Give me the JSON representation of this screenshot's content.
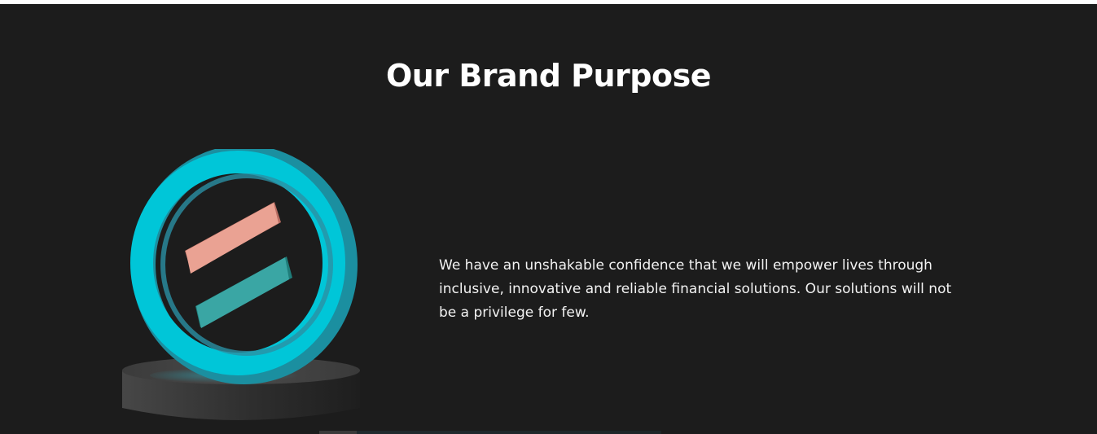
{
  "section": {
    "title": "Our Brand Purpose",
    "description": "We have an unshakable confidence that we will empower lives through inclusive, innovative and reliable financial solutions. Our solutions will not be a privilege for few."
  },
  "illustration": {
    "icon": "brand-logo-ring-on-pedestal-icon",
    "colors": {
      "ring": "#00c6d8",
      "stripe_top": "#eaa293",
      "stripe_bottom": "#3aa6a4",
      "pedestal": "#333333"
    }
  },
  "colors": {
    "background": "#1c1c1c",
    "title": "#ffffff",
    "text": "#f2f2f2"
  }
}
